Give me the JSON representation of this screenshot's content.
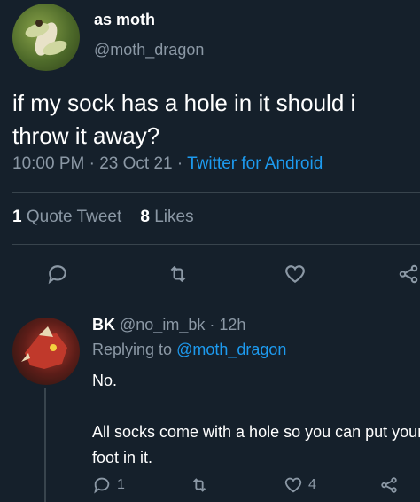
{
  "main_tweet": {
    "display_name": "as moth",
    "handle": "@moth_dragon",
    "text": "if my sock has a hole in it should i throw it away?",
    "time": "10:00 PM",
    "date": "23 Oct 21",
    "source": "Twitter for Android",
    "separator": "·",
    "quote_tweets_count": "1",
    "quote_tweets_label": "Quote Tweet",
    "likes_count": "8",
    "likes_label": "Likes",
    "actions": [
      "reply-icon",
      "retweet-icon",
      "like-icon",
      "share-icon"
    ]
  },
  "reply_tweet": {
    "display_name": "BK",
    "handle": "@no_im_bk",
    "separator": "·",
    "age": "12h",
    "replying_prefix": "Replying to",
    "replying_to": "@moth_dragon",
    "text": "No.\n\nAll socks come with a hole so you can put your foot in it.",
    "reply_count": "1",
    "retweet_count": "",
    "like_count": "4"
  },
  "colors": {
    "background": "#15202b",
    "text_primary": "#ffffff",
    "text_secondary": "#8b98a5",
    "link": "#1d9bf0",
    "divider": "#38444d"
  }
}
